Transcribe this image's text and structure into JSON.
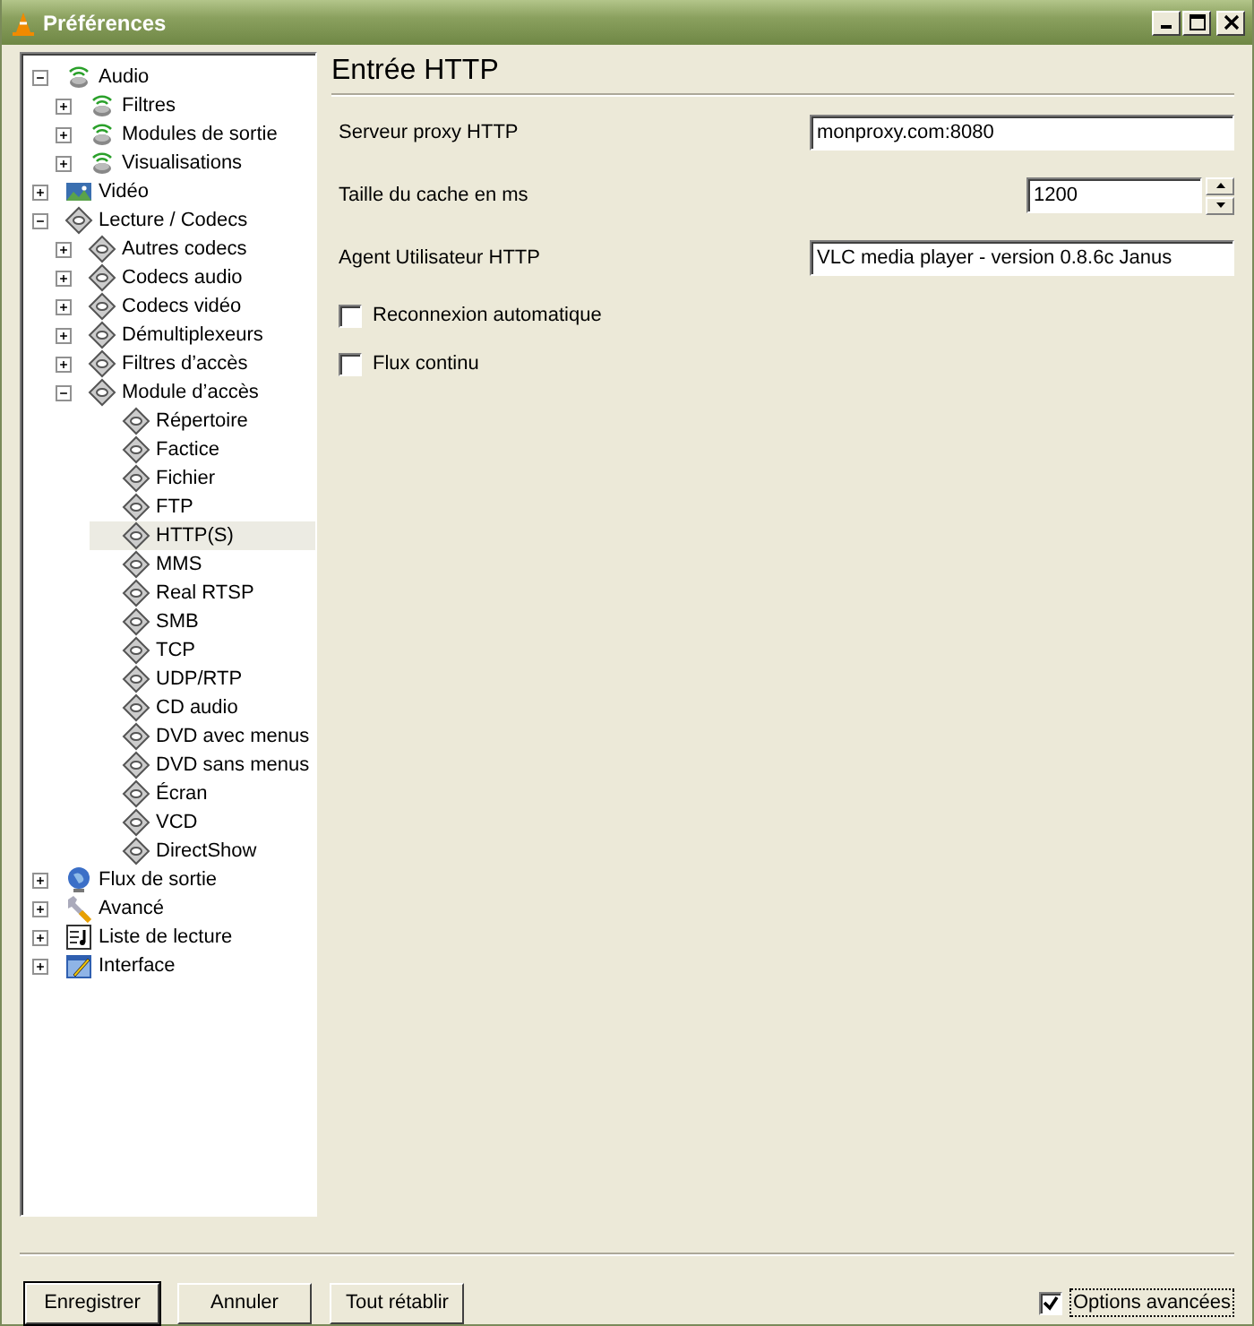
{
  "window": {
    "title": "Préférences"
  },
  "tree": [
    {
      "label": "Audio",
      "kind": "speaker",
      "expanded": true,
      "selected": false,
      "children": [
        {
          "label": "Filtres",
          "kind": "speaker",
          "expanded": false,
          "selected": false
        },
        {
          "label": "Modules de sortie",
          "kind": "speaker",
          "expanded": false,
          "selected": false
        },
        {
          "label": "Visualisations",
          "kind": "speaker",
          "expanded": false,
          "selected": false
        }
      ]
    },
    {
      "label": "Vidéo",
      "kind": "video",
      "expanded": false,
      "selected": false
    },
    {
      "label": "Lecture / Codecs",
      "kind": "disc",
      "expanded": true,
      "selected": false,
      "children": [
        {
          "label": "Autres codecs",
          "kind": "disc",
          "expanded": false,
          "selected": false
        },
        {
          "label": "Codecs audio",
          "kind": "disc",
          "expanded": false,
          "selected": false
        },
        {
          "label": "Codecs vidéo",
          "kind": "disc",
          "expanded": false,
          "selected": false
        },
        {
          "label": "Démultiplexeurs",
          "kind": "disc",
          "expanded": false,
          "selected": false
        },
        {
          "label": "Filtres d’accès",
          "kind": "disc",
          "expanded": false,
          "selected": false
        },
        {
          "label": "Module d’accès",
          "kind": "disc",
          "expanded": true,
          "selected": false,
          "children": [
            {
              "label": "Répertoire",
              "kind": "disc",
              "selected": false
            },
            {
              "label": "Factice",
              "kind": "disc",
              "selected": false
            },
            {
              "label": "Fichier",
              "kind": "disc",
              "selected": false
            },
            {
              "label": "FTP",
              "kind": "disc",
              "selected": false
            },
            {
              "label": "HTTP(S)",
              "kind": "disc",
              "selected": true
            },
            {
              "label": "MMS",
              "kind": "disc",
              "selected": false
            },
            {
              "label": "Real RTSP",
              "kind": "disc",
              "selected": false
            },
            {
              "label": "SMB",
              "kind": "disc",
              "selected": false
            },
            {
              "label": "TCP",
              "kind": "disc",
              "selected": false
            },
            {
              "label": "UDP/RTP",
              "kind": "disc",
              "selected": false
            },
            {
              "label": "CD audio",
              "kind": "disc",
              "selected": false
            },
            {
              "label": "DVD avec menus",
              "kind": "disc",
              "selected": false
            },
            {
              "label": "DVD sans menus",
              "kind": "disc",
              "selected": false
            },
            {
              "label": "Écran",
              "kind": "disc",
              "selected": false
            },
            {
              "label": "VCD",
              "kind": "disc",
              "selected": false
            },
            {
              "label": "DirectShow",
              "kind": "disc",
              "selected": false
            }
          ]
        }
      ]
    },
    {
      "label": "Flux de sortie",
      "kind": "globe",
      "expanded": false,
      "selected": false
    },
    {
      "label": "Avancé",
      "kind": "wrench",
      "expanded": false,
      "selected": false
    },
    {
      "label": "Liste de lecture",
      "kind": "playlist",
      "expanded": false,
      "selected": false
    },
    {
      "label": "Interface",
      "kind": "interface",
      "expanded": false,
      "selected": false
    }
  ],
  "panel": {
    "title": "Entrée HTTP",
    "settings": [
      {
        "kind": "text",
        "label": "Serveur proxy HTTP",
        "value": "monproxy.com:8080"
      },
      {
        "kind": "spin",
        "label": "Taille du cache en ms",
        "value": "1200"
      },
      {
        "kind": "text",
        "label": "Agent Utilisateur HTTP",
        "value": "VLC media player - version 0.8.6c Janus"
      },
      {
        "kind": "checkbox",
        "label": "Reconnexion automatique",
        "checked": false
      },
      {
        "kind": "checkbox",
        "label": "Flux continu",
        "checked": false
      }
    ]
  },
  "buttons": [
    {
      "label": "Enregistrer",
      "default": true
    },
    {
      "label": "Annuler",
      "default": false
    },
    {
      "label": "Tout rétablir",
      "default": false
    }
  ],
  "advanced": {
    "label": "Options avancées",
    "checked": true,
    "focused": true
  }
}
